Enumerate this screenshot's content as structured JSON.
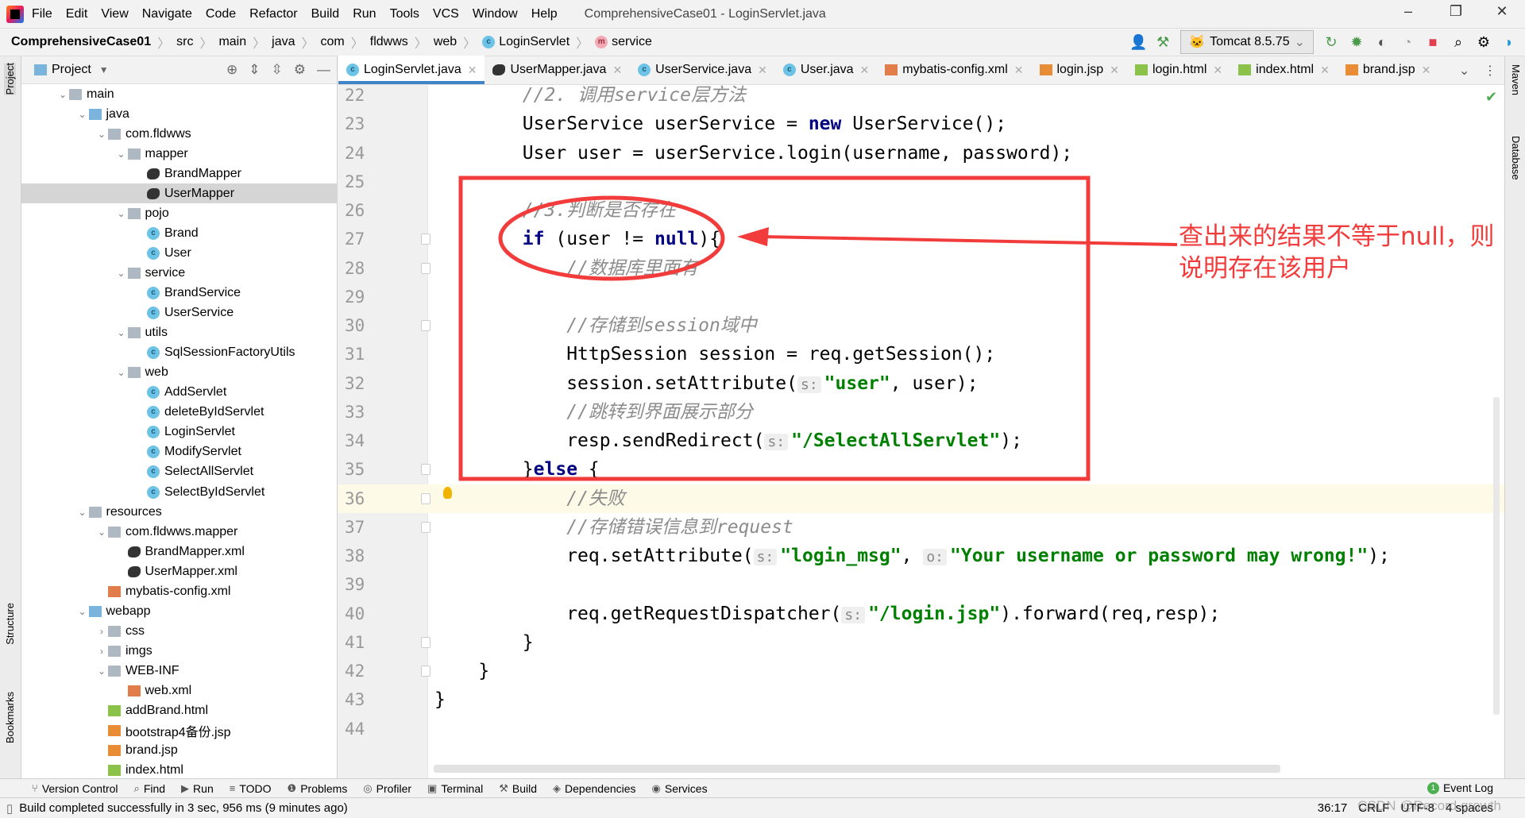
{
  "menubar": {
    "items": [
      "File",
      "Edit",
      "View",
      "Navigate",
      "Code",
      "Refactor",
      "Build",
      "Run",
      "Tools",
      "VCS",
      "Window",
      "Help"
    ],
    "title": "ComprehensiveCase01 - LoginServlet.java"
  },
  "breadcrumb": {
    "project": "ComprehensiveCase01",
    "items": [
      "src",
      "main",
      "java",
      "com",
      "fldwws",
      "web"
    ],
    "class": "LoginServlet",
    "method": "service"
  },
  "toolbar": {
    "run_config": "Tomcat 8.5.75"
  },
  "project_panel": {
    "title": "Project"
  },
  "tree": [
    {
      "label": "main",
      "level": 0,
      "type": "folder",
      "arrow": "down"
    },
    {
      "label": "java",
      "level": 1,
      "type": "folder-src",
      "arrow": "down"
    },
    {
      "label": "com.fldwws",
      "level": 2,
      "type": "pkg",
      "arrow": "down"
    },
    {
      "label": "mapper",
      "level": 3,
      "type": "pkg",
      "arrow": "down"
    },
    {
      "label": "BrandMapper",
      "level": 4,
      "type": "mapper"
    },
    {
      "label": "UserMapper",
      "level": 4,
      "type": "mapper",
      "selected": true
    },
    {
      "label": "pojo",
      "level": 3,
      "type": "pkg",
      "arrow": "down"
    },
    {
      "label": "Brand",
      "level": 4,
      "type": "cls"
    },
    {
      "label": "User",
      "level": 4,
      "type": "cls"
    },
    {
      "label": "service",
      "level": 3,
      "type": "pkg",
      "arrow": "down"
    },
    {
      "label": "BrandService",
      "level": 4,
      "type": "cls"
    },
    {
      "label": "UserService",
      "level": 4,
      "type": "cls"
    },
    {
      "label": "utils",
      "level": 3,
      "type": "pkg",
      "arrow": "down"
    },
    {
      "label": "SqlSessionFactoryUtils",
      "level": 4,
      "type": "cls"
    },
    {
      "label": "web",
      "level": 3,
      "type": "pkg",
      "arrow": "down"
    },
    {
      "label": "AddServlet",
      "level": 4,
      "type": "cls"
    },
    {
      "label": "deleteByIdServlet",
      "level": 4,
      "type": "cls"
    },
    {
      "label": "LoginServlet",
      "level": 4,
      "type": "cls"
    },
    {
      "label": "ModifyServlet",
      "level": 4,
      "type": "cls"
    },
    {
      "label": "SelectAllServlet",
      "level": 4,
      "type": "cls"
    },
    {
      "label": "SelectByIdServlet",
      "level": 4,
      "type": "cls"
    },
    {
      "label": "resources",
      "level": 1,
      "type": "folder",
      "arrow": "down"
    },
    {
      "label": "com.fldwws.mapper",
      "level": 2,
      "type": "folder",
      "arrow": "down"
    },
    {
      "label": "BrandMapper.xml",
      "level": 3,
      "type": "mapper"
    },
    {
      "label": "UserMapper.xml",
      "level": 3,
      "type": "mapper"
    },
    {
      "label": "mybatis-config.xml",
      "level": 2,
      "type": "xml"
    },
    {
      "label": "webapp",
      "level": 1,
      "type": "folder-src",
      "arrow": "down"
    },
    {
      "label": "css",
      "level": 2,
      "type": "folder",
      "arrow": "right"
    },
    {
      "label": "imgs",
      "level": 2,
      "type": "folder",
      "arrow": "right"
    },
    {
      "label": "WEB-INF",
      "level": 2,
      "type": "folder",
      "arrow": "down"
    },
    {
      "label": "web.xml",
      "level": 3,
      "type": "xml"
    },
    {
      "label": "addBrand.html",
      "level": 2,
      "type": "html"
    },
    {
      "label": "bootstrap4备份.jsp",
      "level": 2,
      "type": "jsp"
    },
    {
      "label": "brand.jsp",
      "level": 2,
      "type": "jsp"
    },
    {
      "label": "index.html",
      "level": 2,
      "type": "html"
    }
  ],
  "tabs": [
    {
      "label": "LoginServlet.java",
      "type": "cls",
      "active": true
    },
    {
      "label": "UserMapper.java",
      "type": "mapper"
    },
    {
      "label": "UserService.java",
      "type": "cls"
    },
    {
      "label": "User.java",
      "type": "cls"
    },
    {
      "label": "mybatis-config.xml",
      "type": "xml"
    },
    {
      "label": "login.jsp",
      "type": "jsp"
    },
    {
      "label": "login.html",
      "type": "html"
    },
    {
      "label": "index.html",
      "type": "html"
    },
    {
      "label": "brand.jsp",
      "type": "jsp"
    }
  ],
  "editor": {
    "current_line": 36,
    "lines": [
      {
        "n": "22",
        "indent": 8,
        "seg": [
          {
            "t": "//2. 调用service层方法",
            "c": "cm"
          }
        ]
      },
      {
        "n": "23",
        "indent": 8,
        "seg": [
          {
            "t": "UserService userService = ",
            "c": ""
          },
          {
            "t": "new",
            "c": "kw"
          },
          {
            "t": " UserService();",
            "c": ""
          }
        ]
      },
      {
        "n": "24",
        "indent": 8,
        "seg": [
          {
            "t": "User user = userService.login(username, password);",
            "c": ""
          }
        ]
      },
      {
        "n": "25",
        "indent": 8,
        "seg": []
      },
      {
        "n": "26",
        "indent": 8,
        "seg": [
          {
            "t": "//3.判断是否存在",
            "c": "cm"
          }
        ]
      },
      {
        "n": "27",
        "indent": 8,
        "seg": [
          {
            "t": "if",
            "c": "kw"
          },
          {
            "t": " (user != ",
            "c": ""
          },
          {
            "t": "null",
            "c": "kw"
          },
          {
            "t": "){",
            "c": ""
          }
        ]
      },
      {
        "n": "28",
        "indent": 12,
        "seg": [
          {
            "t": "//数据库里面有",
            "c": "cm"
          }
        ]
      },
      {
        "n": "29",
        "indent": 12,
        "seg": []
      },
      {
        "n": "30",
        "indent": 12,
        "seg": [
          {
            "t": "//存储到session域中",
            "c": "cm"
          }
        ]
      },
      {
        "n": "31",
        "indent": 12,
        "seg": [
          {
            "t": "HttpSession session = req.getSession();",
            "c": ""
          }
        ]
      },
      {
        "n": "32",
        "indent": 12,
        "seg": [
          {
            "t": "session.setAttribute(",
            "c": ""
          },
          {
            "t": "s:",
            "c": "hint"
          },
          {
            "t": "\"user\"",
            "c": "str"
          },
          {
            "t": ", user);",
            "c": ""
          }
        ]
      },
      {
        "n": "33",
        "indent": 12,
        "seg": [
          {
            "t": "//跳转到界面展示部分",
            "c": "cm"
          }
        ]
      },
      {
        "n": "34",
        "indent": 12,
        "seg": [
          {
            "t": "resp.sendRedirect(",
            "c": ""
          },
          {
            "t": "s:",
            "c": "hint"
          },
          {
            "t": "\"/SelectAllServlet\"",
            "c": "str"
          },
          {
            "t": ");",
            "c": ""
          }
        ]
      },
      {
        "n": "35",
        "indent": 8,
        "seg": [
          {
            "t": "}",
            "c": ""
          },
          {
            "t": "else",
            "c": "kw"
          },
          {
            "t": " {",
            "c": ""
          }
        ]
      },
      {
        "n": "36",
        "indent": 12,
        "seg": [
          {
            "t": "//失败",
            "c": "cm"
          }
        ]
      },
      {
        "n": "37",
        "indent": 12,
        "seg": [
          {
            "t": "//存储错误信息到request",
            "c": "cm"
          }
        ]
      },
      {
        "n": "38",
        "indent": 12,
        "seg": [
          {
            "t": "req.setAttribute(",
            "c": ""
          },
          {
            "t": "s:",
            "c": "hint"
          },
          {
            "t": "\"login_msg\"",
            "c": "str"
          },
          {
            "t": ", ",
            "c": ""
          },
          {
            "t": "o:",
            "c": "hint"
          },
          {
            "t": "\"Your username or password may wrong!\"",
            "c": "str"
          },
          {
            "t": ");",
            "c": ""
          }
        ]
      },
      {
        "n": "39",
        "indent": 12,
        "seg": []
      },
      {
        "n": "40",
        "indent": 12,
        "seg": [
          {
            "t": "req.getRequestDispatcher(",
            "c": ""
          },
          {
            "t": "s:",
            "c": "hint"
          },
          {
            "t": "\"/login.jsp\"",
            "c": "str"
          },
          {
            "t": ").forward(req,resp);",
            "c": ""
          }
        ]
      },
      {
        "n": "41",
        "indent": 8,
        "seg": [
          {
            "t": "}",
            "c": ""
          }
        ]
      },
      {
        "n": "42",
        "indent": 4,
        "seg": [
          {
            "t": "}",
            "c": ""
          }
        ]
      },
      {
        "n": "43",
        "indent": 0,
        "seg": [
          {
            "t": "}",
            "c": ""
          }
        ]
      },
      {
        "n": "44",
        "indent": 0,
        "seg": []
      }
    ]
  },
  "annotation": {
    "text": "查出来的结果不等于null，则说明存在该用户",
    "color": "#f23c3c"
  },
  "left_stripe": [
    "Project",
    "Structure",
    "Bookmarks"
  ],
  "right_stripe": [
    "Maven",
    "Database"
  ],
  "toolwindows": [
    "Version Control",
    "Find",
    "Run",
    "TODO",
    "Problems",
    "Profiler",
    "Terminal",
    "Build",
    "Dependencies",
    "Services"
  ],
  "event_log": {
    "label": "Event Log",
    "count": "1"
  },
  "status": {
    "message": "Build completed successfully in 3 sec, 956 ms (9 minutes ago)",
    "position": "36:17",
    "line_sep": "CRLF",
    "encoding": "UTF-8",
    "indent": "4 spaces",
    "watermark": "CSDN @Record growth"
  }
}
